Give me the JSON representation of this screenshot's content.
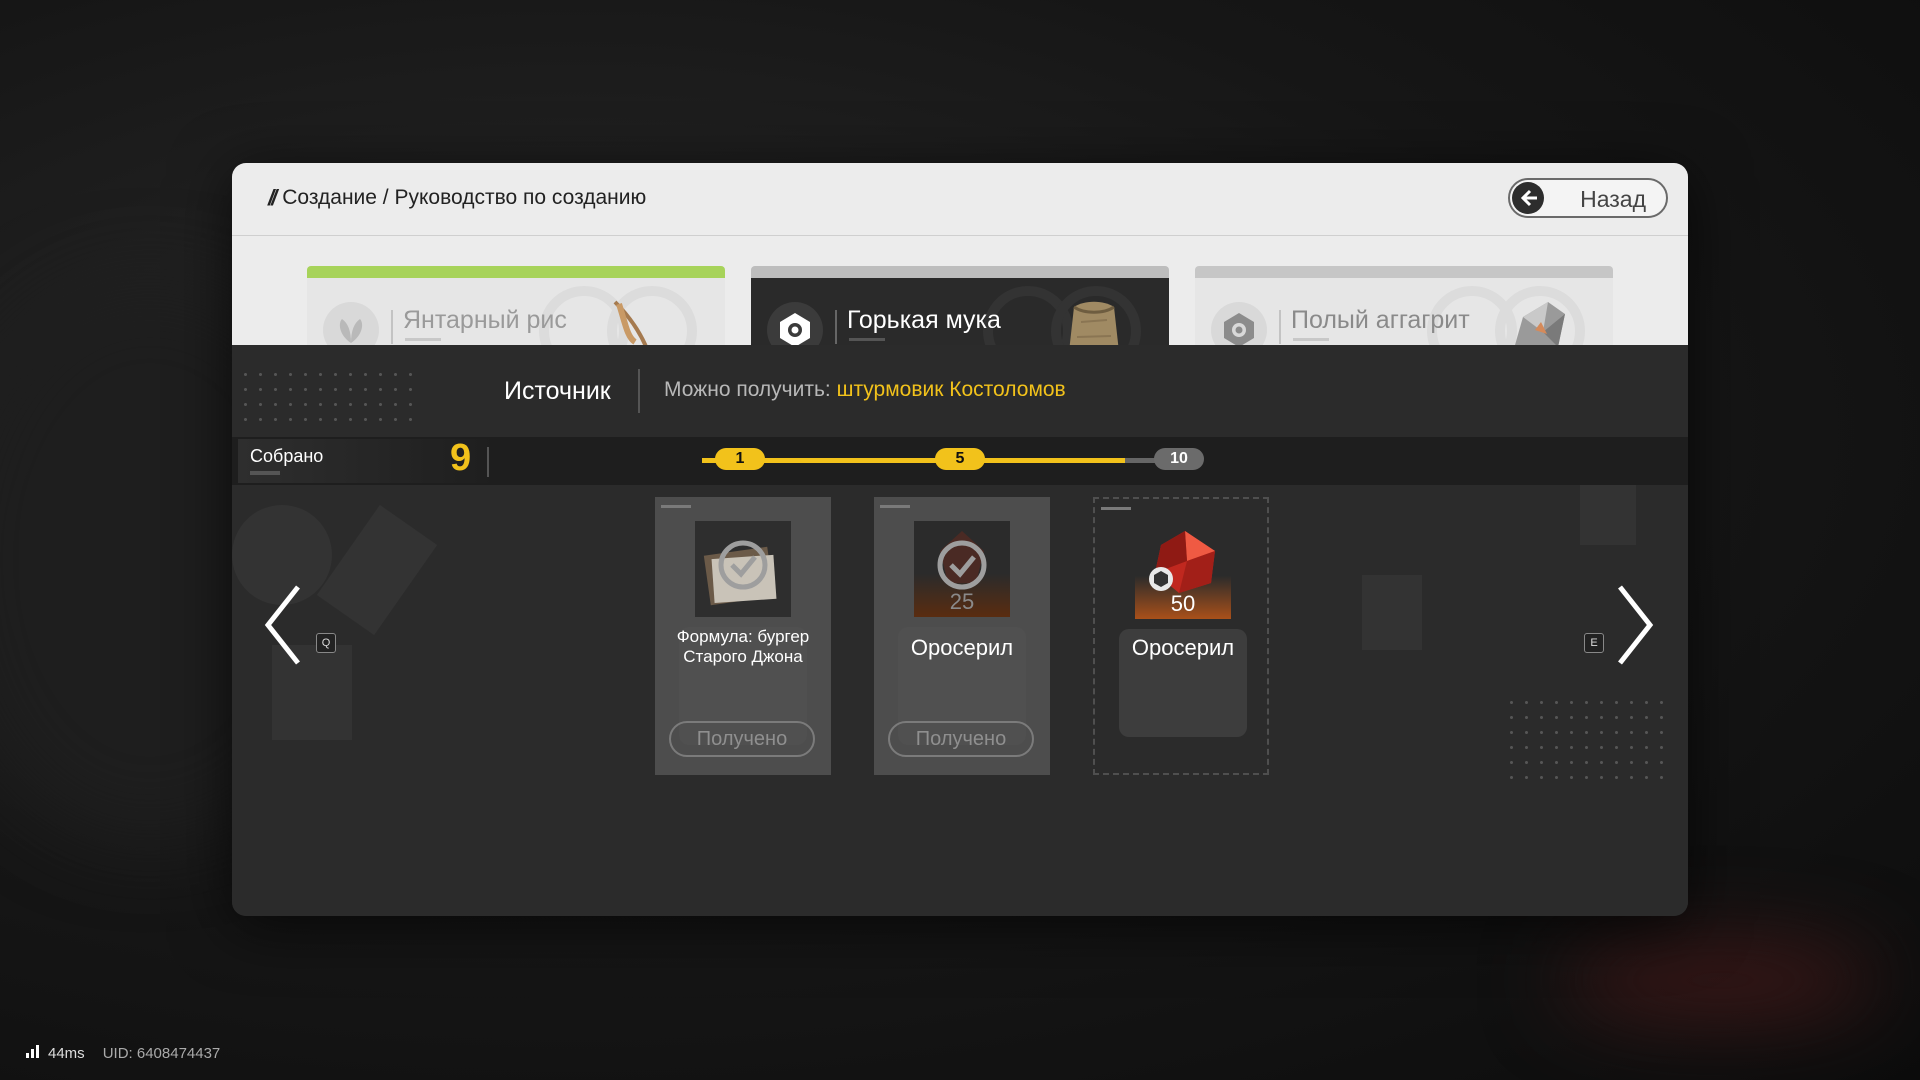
{
  "header": {
    "breadcrumb": "Создание / Руководство по созданию",
    "back_label": "Назад"
  },
  "tabs": [
    {
      "label": "Янтарный рис",
      "state": "inactive",
      "accent": "#a7d35a"
    },
    {
      "label": "Горькая мука",
      "state": "selected",
      "accent": "#bdbdbd"
    },
    {
      "label": "Полый аггагрит",
      "state": "inactive",
      "accent": "#c6c6c6"
    }
  ],
  "source": {
    "title": "Источник",
    "prefix": "Можно получить:",
    "link": "штурмовик Костоломов"
  },
  "progress": {
    "collected_label": "Собрано",
    "collected_count": "9",
    "milestones": [
      "1",
      "5",
      "10"
    ],
    "fill_fraction": 0.9
  },
  "nav": {
    "prev_key": "Q",
    "next_key": "E"
  },
  "rewards": [
    {
      "name": "Формула: бургер Старого Джона",
      "quantity": "",
      "button": "Получено",
      "claimed": true
    },
    {
      "name": "Оросерил",
      "quantity": "25",
      "button": "Получено",
      "claimed": true
    },
    {
      "name": "Оросерил",
      "quantity": "50",
      "button": "",
      "claimed": false
    }
  ],
  "footer": {
    "ping": "44ms",
    "uid": "UID: 6408474437"
  },
  "colors": {
    "accent_yellow": "#f2c21b",
    "panel_dark": "#2b2b2b",
    "panel_light": "#ececec"
  }
}
